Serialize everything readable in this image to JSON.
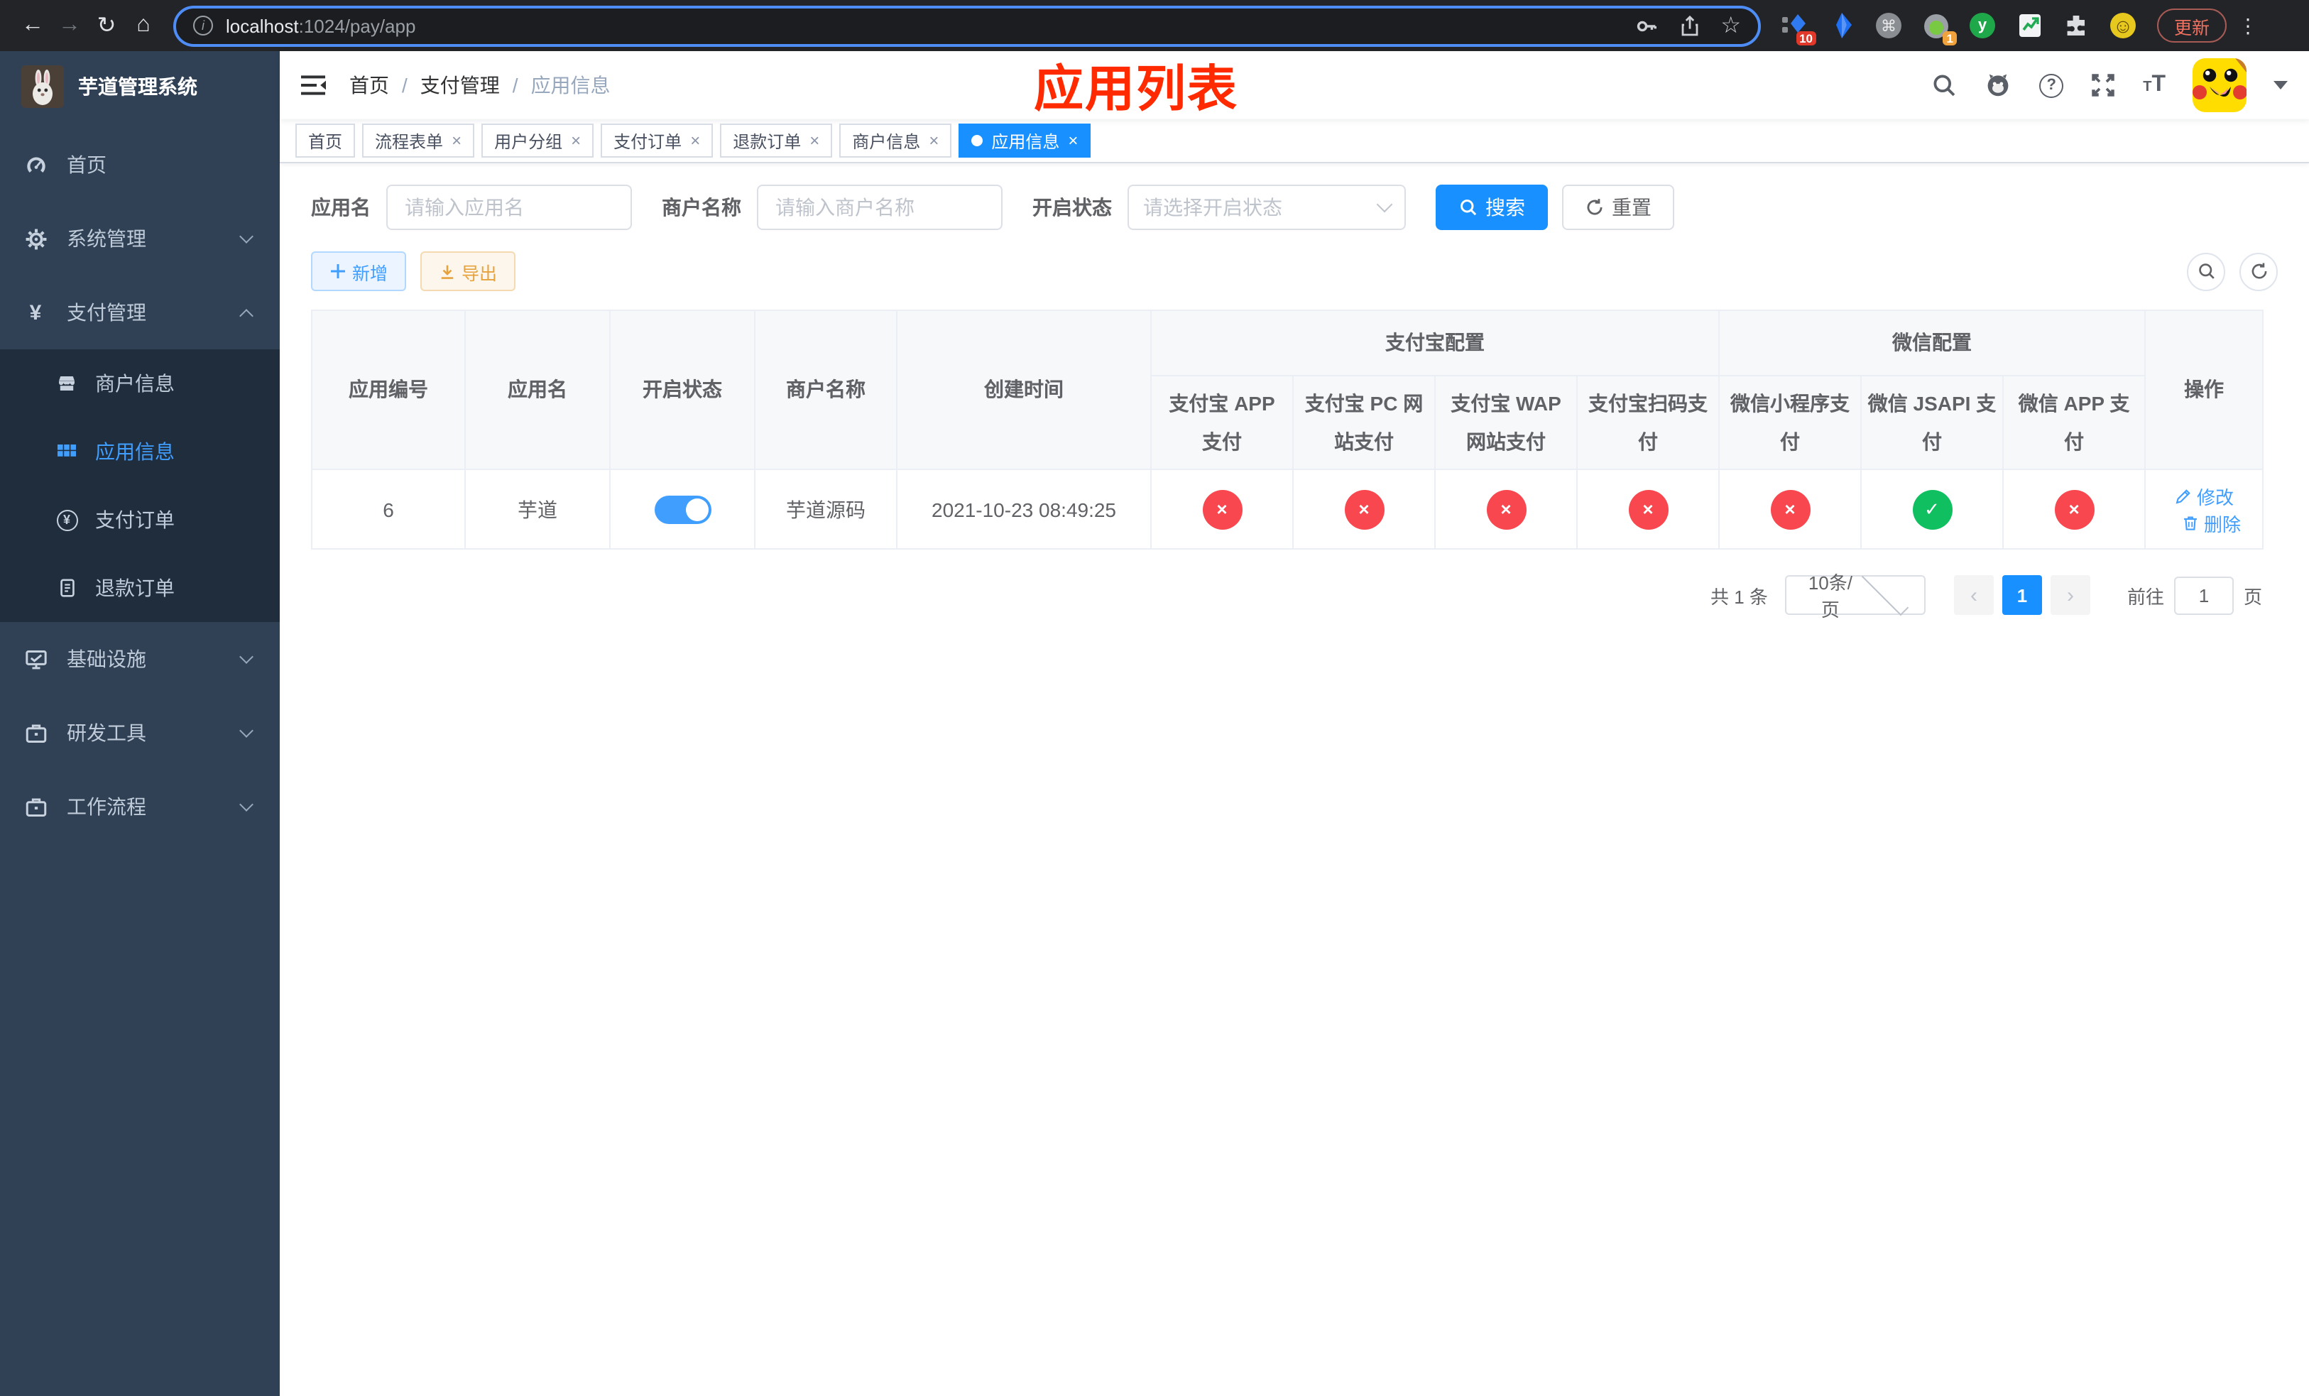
{
  "browser": {
    "url": {
      "host": "localhost",
      "rest": ":1024/pay/app"
    },
    "update_button": "更新",
    "ext_badge_blue": "10",
    "ext_badge_record": "1"
  },
  "icons": {
    "back": "←",
    "forward": "→",
    "reload": "↻",
    "home": "⌂",
    "info": "i",
    "star": "☆",
    "command": "⌘",
    "kebab": "⋮",
    "question": "?",
    "font_small": "T",
    "font_large": "T",
    "yen": "¥",
    "close": "×",
    "check": "✓",
    "cross": "×",
    "prev": "‹",
    "next": "›",
    "y_ext": "y",
    "smile": "☺"
  },
  "colors": {
    "primary": "#1890ff",
    "link": "#409eff",
    "danger": "#f8474e",
    "success": "#10bf60",
    "sidebar_bg": "#304156",
    "submenu_bg": "#1f2d3d",
    "annotation_red": "#ff2a00"
  },
  "sidebar": {
    "title": "芋道管理系统",
    "menu": [
      {
        "label": "首页",
        "icon": "dashboard-icon"
      },
      {
        "label": "系统管理",
        "icon": "gear-icon"
      },
      {
        "label": "支付管理",
        "icon": "yen-icon"
      },
      {
        "label": "商户信息",
        "icon": "store-icon"
      },
      {
        "label": "应用信息",
        "icon": "grid-icon"
      },
      {
        "label": "支付订单",
        "icon": "yen-circle-icon"
      },
      {
        "label": "退款订单",
        "icon": "document-icon"
      },
      {
        "label": "基础设施",
        "icon": "monitor-icon"
      },
      {
        "label": "研发工具",
        "icon": "briefcase-icon"
      },
      {
        "label": "工作流程",
        "icon": "briefcase-icon"
      }
    ]
  },
  "header": {
    "breadcrumb": {
      "home": "首页",
      "section": "支付管理",
      "current": "应用信息"
    },
    "page_title": "应用列表"
  },
  "tabs": [
    {
      "label": "首页"
    },
    {
      "label": "流程表单"
    },
    {
      "label": "用户分组"
    },
    {
      "label": "支付订单"
    },
    {
      "label": "退款订单"
    },
    {
      "label": "商户信息"
    },
    {
      "label": "应用信息"
    }
  ],
  "filters": {
    "app_name_label": "应用名",
    "app_name_placeholder": "请输入应用名",
    "merchant_label": "商户名称",
    "merchant_placeholder": "请输入商户名称",
    "status_label": "开启状态",
    "status_placeholder": "请选择开启状态",
    "search": "搜索",
    "reset": "重置"
  },
  "toolbar": {
    "add": "新增",
    "export": "导出"
  },
  "table": {
    "headers": {
      "app_id": "应用编号",
      "app_name": "应用名",
      "status": "开启状态",
      "merchant": "商户名称",
      "created": "创建时间",
      "alipay_group": "支付宝配置",
      "wechat_group": "微信配置",
      "alipay_app": "支付宝 APP 支付",
      "alipay_pc": "支付宝 PC 网站支付",
      "alipay_wap": "支付宝 WAP 网站支付",
      "alipay_qr": "支付宝扫码支付",
      "wx_mini": "微信小程序支付",
      "wx_jsapi": "微信 JSAPI 支付",
      "wx_app": "微信 APP 支付",
      "actions": "操作"
    },
    "row": {
      "app_id": "6",
      "app_name": "芋道",
      "status_on": true,
      "merchant": "芋道源码",
      "created": "2021-10-23 08:49:25",
      "configs": [
        false,
        false,
        false,
        false,
        false,
        true,
        false
      ],
      "edit": "修改",
      "delete": "删除"
    }
  },
  "pagination": {
    "total": "共 1 条",
    "page_size": "10条/页",
    "page": "1",
    "goto_prefix": "前往",
    "goto_value": "1",
    "goto_suffix": "页"
  }
}
